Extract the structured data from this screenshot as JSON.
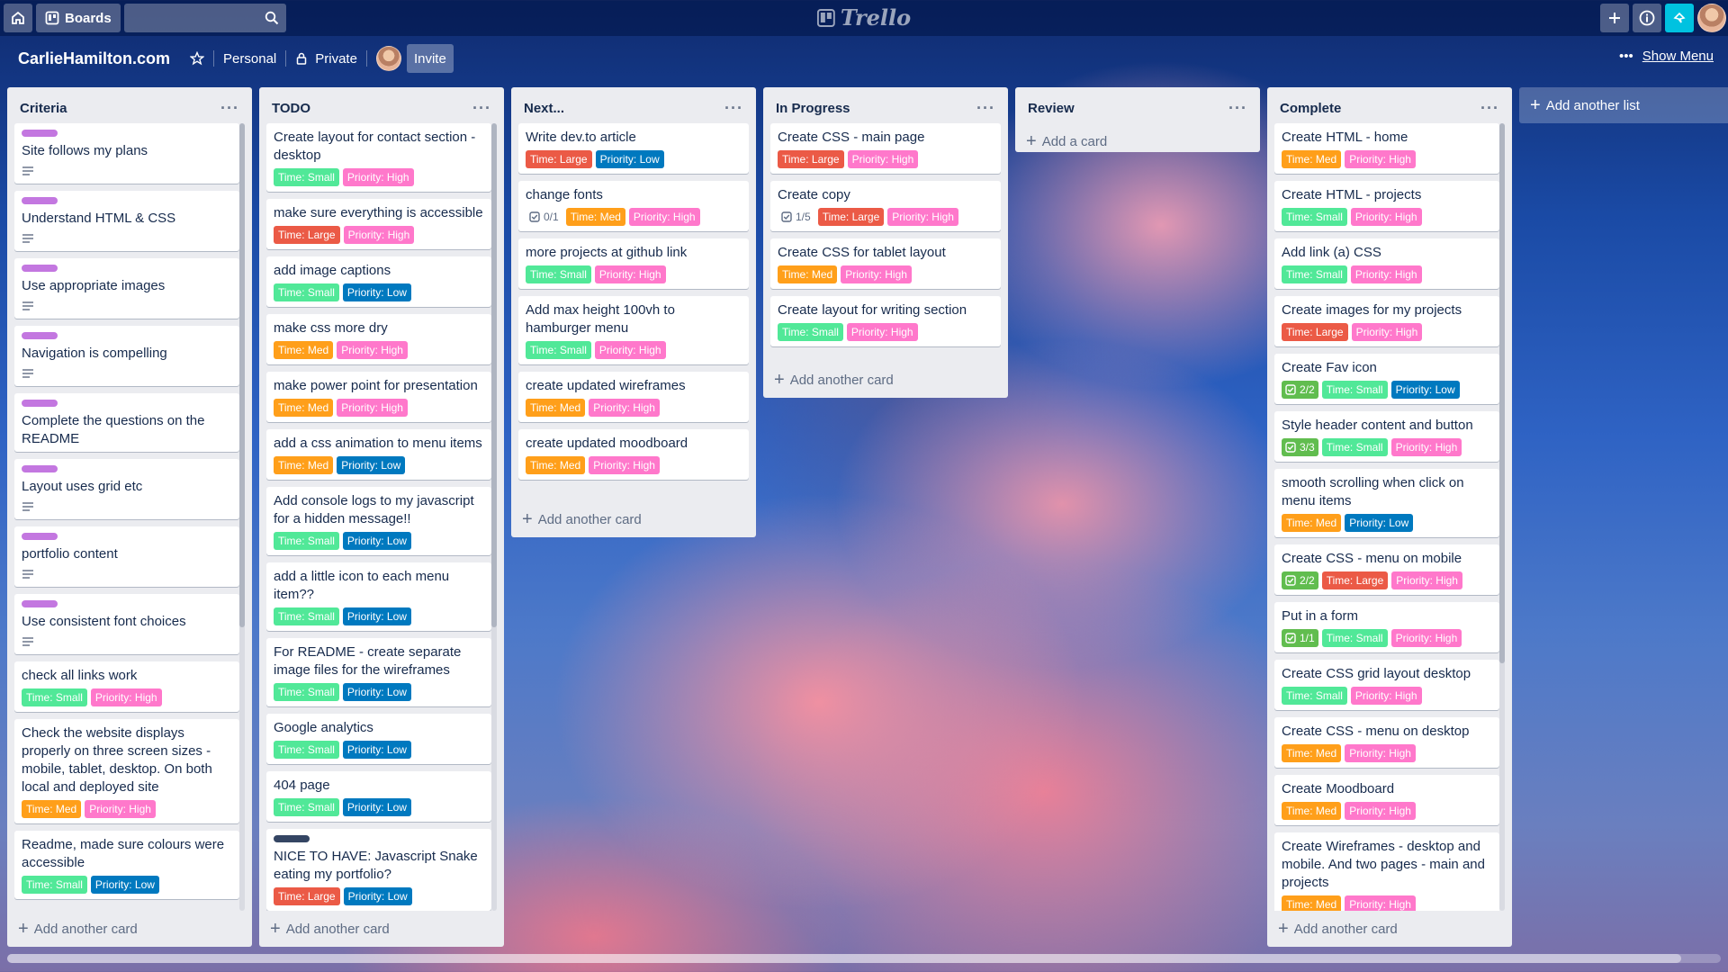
{
  "header": {
    "boards_label": "Boards",
    "logo_text": "Trello"
  },
  "board": {
    "title": "CarlieHamilton.com",
    "team": "Personal",
    "visibility": "Private",
    "invite_label": "Invite",
    "show_menu_label": "Show Menu"
  },
  "add_list_label": "Add another list",
  "lists": [
    {
      "title": "Criteria",
      "add_label": "Add another card",
      "cards": [
        {
          "title": "Site follows my plans",
          "labelStrip": "purple",
          "desc": true,
          "tags": []
        },
        {
          "title": "Understand HTML & CSS",
          "labelStrip": "purple",
          "desc": true,
          "tags": []
        },
        {
          "title": "Use appropriate images",
          "labelStrip": "purple",
          "desc": true,
          "tags": []
        },
        {
          "title": "Navigation is compelling",
          "labelStrip": "purple",
          "desc": true,
          "tags": []
        },
        {
          "title": "Complete the questions on the README",
          "labelStrip": "purple",
          "desc": false,
          "tags": []
        },
        {
          "title": "Layout uses grid etc",
          "labelStrip": "purple",
          "desc": true,
          "tags": []
        },
        {
          "title": "portfolio content",
          "labelStrip": "purple",
          "desc": true,
          "tags": []
        },
        {
          "title": "Use consistent font choices",
          "labelStrip": "purple",
          "desc": true,
          "tags": []
        },
        {
          "title": "check all links work",
          "tags": [
            {
              "text": "Time: Small",
              "kind": "t-small"
            },
            {
              "text": "Priority: High",
              "kind": "p-high"
            }
          ]
        },
        {
          "title": "Check the website displays properly on three screen sizes - mobile, tablet, desktop. On both local and deployed site",
          "tags": [
            {
              "text": "Time: Med",
              "kind": "t-med"
            },
            {
              "text": "Priority: High",
              "kind": "p-high"
            }
          ]
        },
        {
          "title": "Readme, made sure colours were accessible",
          "tags": [
            {
              "text": "Time: Small",
              "kind": "t-small"
            },
            {
              "text": "Priority: Low",
              "kind": "p-low"
            }
          ]
        }
      ]
    },
    {
      "title": "TODO",
      "add_label": "Add another card",
      "cards": [
        {
          "title": "Create layout for contact section - desktop",
          "tags": [
            {
              "text": "Time: Small",
              "kind": "t-small"
            },
            {
              "text": "Priority: High",
              "kind": "p-high"
            }
          ]
        },
        {
          "title": "make sure everything is accessible",
          "tags": [
            {
              "text": "Time: Large",
              "kind": "t-large"
            },
            {
              "text": "Priority: High",
              "kind": "p-high"
            }
          ]
        },
        {
          "title": "add image captions",
          "tags": [
            {
              "text": "Time: Small",
              "kind": "t-small"
            },
            {
              "text": "Priority: Low",
              "kind": "p-low"
            }
          ]
        },
        {
          "title": "make css more dry",
          "tags": [
            {
              "text": "Time: Med",
              "kind": "t-med"
            },
            {
              "text": "Priority: High",
              "kind": "p-high"
            }
          ]
        },
        {
          "title": "make power point for presentation",
          "tags": [
            {
              "text": "Time: Med",
              "kind": "t-med"
            },
            {
              "text": "Priority: High",
              "kind": "p-high"
            }
          ]
        },
        {
          "title": "add a css animation to menu items",
          "tags": [
            {
              "text": "Time: Med",
              "kind": "t-med"
            },
            {
              "text": "Priority: Low",
              "kind": "p-low"
            }
          ]
        },
        {
          "title": "Add console logs to my javascript for a hidden message!!",
          "tags": [
            {
              "text": "Time: Small",
              "kind": "t-small"
            },
            {
              "text": "Priority: Low",
              "kind": "p-low"
            }
          ]
        },
        {
          "title": "add a little icon to each menu item??",
          "tags": [
            {
              "text": "Time: Small",
              "kind": "t-small"
            },
            {
              "text": "Priority: Low",
              "kind": "p-low"
            }
          ]
        },
        {
          "title": "For README - create separate image files for the wireframes",
          "tags": [
            {
              "text": "Time: Small",
              "kind": "t-small"
            },
            {
              "text": "Priority: Low",
              "kind": "p-low"
            }
          ]
        },
        {
          "title": "Google analytics",
          "tags": [
            {
              "text": "Time: Small",
              "kind": "t-small"
            },
            {
              "text": "Priority: Low",
              "kind": "p-low"
            }
          ]
        },
        {
          "title": "404 page",
          "tags": [
            {
              "text": "Time: Small",
              "kind": "t-small"
            },
            {
              "text": "Priority: Low",
              "kind": "p-low"
            }
          ]
        },
        {
          "title": "NICE TO HAVE: Javascript Snake eating my portfolio?",
          "labelStrip": "dark",
          "tags": [
            {
              "text": "Time: Large",
              "kind": "t-large"
            },
            {
              "text": "Priority: Low",
              "kind": "p-low"
            }
          ]
        }
      ]
    },
    {
      "title": "Next...",
      "add_label": "Add another card",
      "cards": [
        {
          "title": "Write dev.to article",
          "tags": [
            {
              "text": "Time: Large",
              "kind": "t-large"
            },
            {
              "text": "Priority: Low",
              "kind": "p-low"
            }
          ]
        },
        {
          "title": "change fonts",
          "checklist": "0/1",
          "checkDone": false,
          "tags": [
            {
              "text": "Time: Med",
              "kind": "t-med"
            },
            {
              "text": "Priority: High",
              "kind": "p-high"
            }
          ]
        },
        {
          "title": "more projects at github link",
          "tags": [
            {
              "text": "Time: Small",
              "kind": "t-small"
            },
            {
              "text": "Priority: High",
              "kind": "p-high"
            }
          ]
        },
        {
          "title": "Add max height 100vh to hamburger menu",
          "tags": [
            {
              "text": "Time: Small",
              "kind": "t-small"
            },
            {
              "text": "Priority: High",
              "kind": "p-high"
            }
          ]
        },
        {
          "title": "create updated wireframes",
          "tags": [
            {
              "text": "Time: Med",
              "kind": "t-med"
            },
            {
              "text": "Priority: High",
              "kind": "p-high"
            }
          ]
        },
        {
          "title": "create updated moodboard",
          "tags": [
            {
              "text": "Time: Med",
              "kind": "t-med"
            },
            {
              "text": "Priority: High",
              "kind": "p-high"
            }
          ]
        }
      ]
    },
    {
      "title": "In Progress",
      "add_label": "Add another card",
      "cards": [
        {
          "title": "Create CSS - main page",
          "tags": [
            {
              "text": "Time: Large",
              "kind": "t-large"
            },
            {
              "text": "Priority: High",
              "kind": "p-high"
            }
          ]
        },
        {
          "title": "Create copy",
          "checklist": "1/5",
          "checkDone": false,
          "tags": [
            {
              "text": "Time: Large",
              "kind": "t-large"
            },
            {
              "text": "Priority: High",
              "kind": "p-high"
            }
          ]
        },
        {
          "title": "Create CSS for tablet layout",
          "tags": [
            {
              "text": "Time: Med",
              "kind": "t-med"
            },
            {
              "text": "Priority: High",
              "kind": "p-high"
            }
          ]
        },
        {
          "title": "Create layout for writing section",
          "tags": [
            {
              "text": "Time: Small",
              "kind": "t-small"
            },
            {
              "text": "Priority: High",
              "kind": "p-high"
            }
          ]
        }
      ]
    },
    {
      "title": "Review",
      "add_label": "Add a card",
      "cards": []
    },
    {
      "title": "Complete",
      "add_label": "Add another card",
      "cards": [
        {
          "title": "Create HTML - home",
          "tags": [
            {
              "text": "Time: Med",
              "kind": "t-med"
            },
            {
              "text": "Priority: High",
              "kind": "p-high"
            }
          ]
        },
        {
          "title": "Create HTML - projects",
          "tags": [
            {
              "text": "Time: Small",
              "kind": "t-small"
            },
            {
              "text": "Priority: High",
              "kind": "p-high"
            }
          ]
        },
        {
          "title": "Add link (a) CSS",
          "tags": [
            {
              "text": "Time: Small",
              "kind": "t-small"
            },
            {
              "text": "Priority: High",
              "kind": "p-high"
            }
          ]
        },
        {
          "title": "Create images for my projects",
          "tags": [
            {
              "text": "Time: Large",
              "kind": "t-large"
            },
            {
              "text": "Priority: High",
              "kind": "p-high"
            }
          ]
        },
        {
          "title": "Create Fav icon",
          "checklist": "2/2",
          "checkDone": true,
          "tags": [
            {
              "text": "Time: Small",
              "kind": "t-small"
            },
            {
              "text": "Priority: Low",
              "kind": "p-low"
            }
          ]
        },
        {
          "title": "Style header content and button",
          "checklist": "3/3",
          "checkDone": true,
          "tags": [
            {
              "text": "Time: Small",
              "kind": "t-small"
            },
            {
              "text": "Priority: High",
              "kind": "p-high"
            }
          ]
        },
        {
          "title": "smooth scrolling when click on menu items",
          "tags": [
            {
              "text": "Time: Med",
              "kind": "t-med"
            },
            {
              "text": "Priority: Low",
              "kind": "p-low"
            }
          ]
        },
        {
          "title": "Create CSS - menu on mobile",
          "checklist": "2/2",
          "checkDone": true,
          "tags": [
            {
              "text": "Time: Large",
              "kind": "t-large"
            },
            {
              "text": "Priority: High",
              "kind": "p-high"
            }
          ]
        },
        {
          "title": "Put in a form",
          "checklist": "1/1",
          "checkDone": true,
          "tags": [
            {
              "text": "Time: Small",
              "kind": "t-small"
            },
            {
              "text": "Priority: High",
              "kind": "p-high"
            }
          ]
        },
        {
          "title": "Create CSS grid layout desktop",
          "tags": [
            {
              "text": "Time: Small",
              "kind": "t-small"
            },
            {
              "text": "Priority: High",
              "kind": "p-high"
            }
          ]
        },
        {
          "title": "Create CSS - menu on desktop",
          "tags": [
            {
              "text": "Time: Med",
              "kind": "t-med"
            },
            {
              "text": "Priority: High",
              "kind": "p-high"
            }
          ]
        },
        {
          "title": "Create Moodboard",
          "tags": [
            {
              "text": "Time: Med",
              "kind": "t-med"
            },
            {
              "text": "Priority: High",
              "kind": "p-high"
            }
          ]
        },
        {
          "title": "Create Wireframes - desktop and mobile. And two pages - main and projects",
          "tags": [
            {
              "text": "Time: Med",
              "kind": "t-med"
            },
            {
              "text": "Priority: High",
              "kind": "p-high"
            }
          ]
        }
      ]
    }
  ]
}
